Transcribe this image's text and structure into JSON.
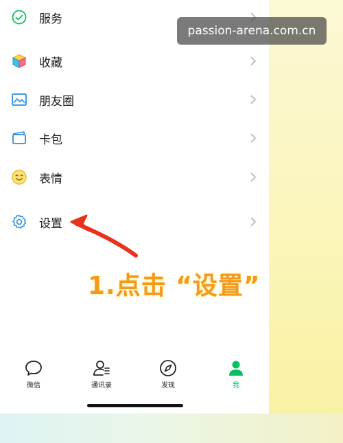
{
  "menu": {
    "items": [
      {
        "label": "服务",
        "icon": "service-icon"
      },
      {
        "label": "收藏",
        "icon": "favorites-cube-icon"
      },
      {
        "label": "朋友圈",
        "icon": "moments-image-icon"
      },
      {
        "label": "卡包",
        "icon": "card-wallet-icon"
      },
      {
        "label": "表情",
        "icon": "emoji-face-icon"
      },
      {
        "label": "设置",
        "icon": "gear-icon"
      }
    ]
  },
  "watermark": {
    "text": "passion-arena.com.cn"
  },
  "callout": {
    "text": "1.点击 “设置”"
  },
  "tabbar": {
    "tabs": [
      {
        "label": "微信",
        "icon": "chat-bubble-icon"
      },
      {
        "label": "通讯录",
        "icon": "contacts-icon"
      },
      {
        "label": "发现",
        "icon": "compass-icon"
      },
      {
        "label": "我",
        "icon": "profile-icon",
        "active": true
      }
    ]
  },
  "colors": {
    "accent_green": "#07c160",
    "callout_orange": "#f39a1d",
    "arrow_red": "#e8321c"
  }
}
